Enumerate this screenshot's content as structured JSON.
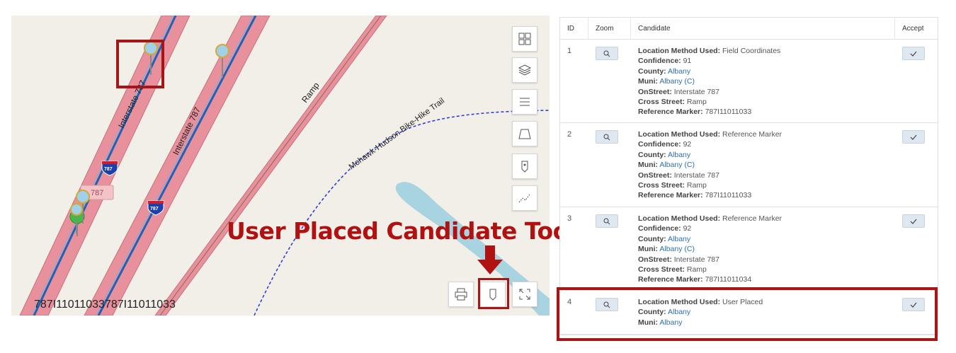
{
  "map": {
    "coords_text": "787I11011033787I11011033",
    "tool_caption": "User Placed Candidate Tool",
    "labels": {
      "interstate_a": "Interstate 787",
      "interstate_b": "Interstate 787",
      "ramp": "Ramp",
      "trail": "Mohawk-Hudson Bike-Hike Trail",
      "shield_1": "787",
      "shield_2": "787",
      "shield_3": "787"
    },
    "tools": [
      "grid-icon",
      "layers-icon",
      "list-icon",
      "polygon-icon",
      "place-marker-icon",
      "line-tool-icon",
      "print-icon",
      "user-placed-marker-icon",
      "expand-icon"
    ]
  },
  "table": {
    "headers": {
      "id": "ID",
      "zoom": "Zoom",
      "candidate": "Candidate",
      "accept": "Accept"
    },
    "rows": [
      {
        "id": "1",
        "method_label": "Location Method Used:",
        "method": "Field Coordinates",
        "confidence_label": "Confidence:",
        "confidence": "91",
        "county_label": "County:",
        "county": "Albany",
        "muni_label": "Muni:",
        "muni": "Albany (C)",
        "onstreet_label": "OnStreet:",
        "onstreet": "Interstate 787",
        "cross_label": "Cross Street:",
        "cross": "Ramp",
        "ref_label": "Reference Marker:",
        "ref": "787I11011033"
      },
      {
        "id": "2",
        "method_label": "Location Method Used:",
        "method": "Reference Marker",
        "confidence_label": "Confidence:",
        "confidence": "92",
        "county_label": "County:",
        "county": "Albany",
        "muni_label": "Muni:",
        "muni": "Albany (C)",
        "onstreet_label": "OnStreet:",
        "onstreet": "Interstate 787",
        "cross_label": "Cross Street:",
        "cross": "Ramp",
        "ref_label": "Reference Marker:",
        "ref": "787I11011033"
      },
      {
        "id": "3",
        "method_label": "Location Method Used:",
        "method": "Reference Marker",
        "confidence_label": "Confidence:",
        "confidence": "92",
        "county_label": "County:",
        "county": "Albany",
        "muni_label": "Muni:",
        "muni": "Albany (C)",
        "onstreet_label": "OnStreet:",
        "onstreet": "Interstate 787",
        "cross_label": "Cross Street:",
        "cross": "Ramp",
        "ref_label": "Reference Marker:",
        "ref": "787I11011034"
      },
      {
        "id": "4",
        "method_label": "Location Method Used:",
        "method": "User Placed",
        "county_label": "County:",
        "county": "Albany",
        "muni_label": "Muni:",
        "muni": "Albany"
      }
    ]
  },
  "colors": {
    "highlight": "#a51616",
    "link": "#2a6fb5",
    "road": "#e8909b",
    "road_line": "#1c63b8"
  }
}
